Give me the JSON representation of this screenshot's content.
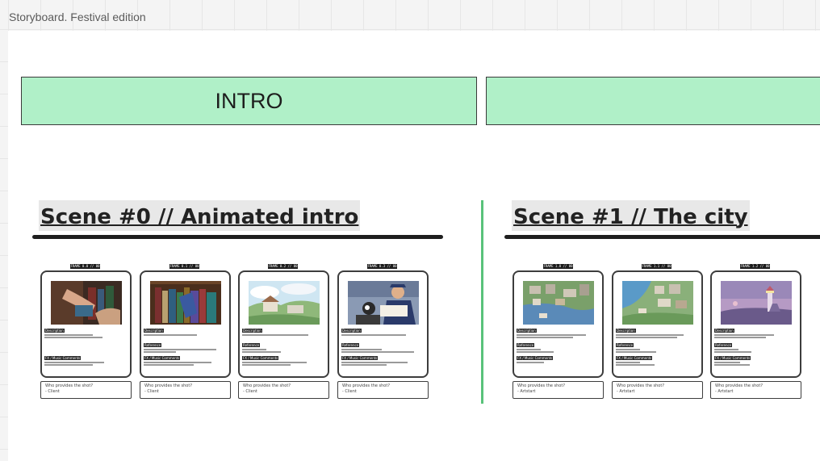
{
  "board": {
    "title": "Storyboard. Festival edition"
  },
  "banners": [
    {
      "label": "INTRO"
    },
    {
      "label": ""
    }
  ],
  "scenes": [
    {
      "title": "Scene #0 // Animated intro",
      "frames": [
        {
          "label": "FRAME 0.0 // 00",
          "thumb": "hands-books-icon",
          "description_head": "Description",
          "reference_head": "Reference",
          "comments_head": "FX / Music Comments",
          "note_q": "Who provides the shot?",
          "note_a": "- Client"
        },
        {
          "label": "FRAME 0.1 // 00",
          "thumb": "bookshelf-icon",
          "description_head": "Description",
          "reference_head": "Reference",
          "comments_head": "FX / Music Comments",
          "note_q": "Who provides the shot?",
          "note_a": "- Client"
        },
        {
          "label": "FRAME 0.2 // 00",
          "thumb": "landscape-icon",
          "description_head": "Description",
          "reference_head": "Reference",
          "comments_head": "FX / Music Comments",
          "note_q": "Who provides the shot?",
          "note_a": "- Client"
        },
        {
          "label": "FRAME 0.3 // 00",
          "thumb": "characters-icon",
          "description_head": "Description",
          "reference_head": "Reference",
          "comments_head": "FX / Music Comments",
          "note_q": "Who provides the shot?",
          "note_a": "- Client"
        }
      ]
    },
    {
      "title": "Scene #1 // The city",
      "frames": [
        {
          "label": "FRAME 1.0 // 00",
          "thumb": "city-aerial-icon",
          "description_head": "Description",
          "reference_head": "Reference",
          "comments_head": "FX / Music Comments",
          "note_q": "Who provides the shot?",
          "note_a": "- Artstart"
        },
        {
          "label": "FRAME 1.1 // 00",
          "thumb": "harbor-aerial-icon",
          "description_head": "Description",
          "reference_head": "Reference",
          "comments_head": "FX / Music Comments",
          "note_q": "Who provides the shot?",
          "note_a": "- Artstart"
        },
        {
          "label": "FRAME 1.2 // 00",
          "thumb": "lighthouse-icon",
          "description_head": "Description",
          "reference_head": "Reference",
          "comments_head": "FX / Music Comments",
          "note_q": "Who provides the shot?",
          "note_a": "- Artstart"
        }
      ]
    }
  ]
}
